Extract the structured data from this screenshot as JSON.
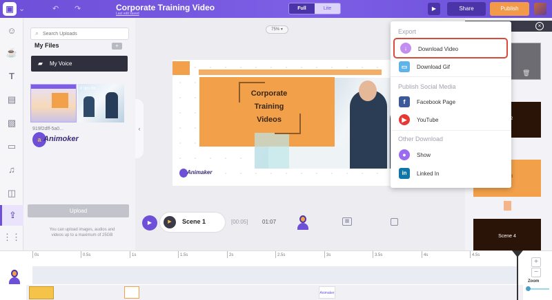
{
  "header": {
    "title": "Corporate Training Video",
    "subtitle": "Last edit saved",
    "view_toggle": [
      "Full",
      "Lite"
    ],
    "share_label": "Share",
    "publish_label": "Publish"
  },
  "rail": {
    "icons": [
      "character-icon",
      "properties-icon",
      "text-icon",
      "background-icon",
      "image-icon",
      "video-icon",
      "music-icon",
      "effect-icon",
      "upload-icon",
      "more-icon"
    ],
    "active": "upload-icon"
  },
  "panel": {
    "search_placeholder": "Search Uploads",
    "section_title": "My Files",
    "add_label": "+",
    "folder_label": "My Voice",
    "thumb2_label": "8 tips for...",
    "file_name": "919f2dff-5a0...",
    "logo_text": "Animoker",
    "upload_label": "Upload",
    "upload_note": "You can upload images, audios and videos up to a maximum of 25GB"
  },
  "canvas": {
    "zoom": "75%",
    "heading_lines": [
      "Corporate",
      "Training",
      "Videos"
    ],
    "logo_text": "Animaker"
  },
  "controls": {
    "scene_label": "Scene 1",
    "time_current": "[00:05]",
    "time_total": "01:07"
  },
  "scenes": {
    "numbers": [
      "2",
      "3"
    ],
    "scene4_label": "Scene 4"
  },
  "dropdown": {
    "categories": [
      "Export",
      "Publish Social Media",
      "Other Download"
    ],
    "items": [
      {
        "label": "Download Video",
        "icon": "download-video-icon",
        "color": "#c28ef0"
      },
      {
        "label": "Download Gif",
        "icon": "gif-icon",
        "color": "#5fb3e9"
      },
      {
        "label": "Facebook Page",
        "icon": "facebook-icon",
        "color": "#3b5998"
      },
      {
        "label": "YouTube",
        "icon": "youtube-icon",
        "color": "#e53935"
      },
      {
        "label": "Show",
        "icon": "show-icon",
        "color": "#9b6bf2"
      },
      {
        "label": "Linked In",
        "icon": "linkedin-icon",
        "color": "#0e76a8"
      }
    ],
    "highlighted": "Download Video"
  },
  "timeline": {
    "ticks": [
      "0s",
      "0.5s",
      "1s",
      "1.5s",
      "2s",
      "2.5s",
      "3s",
      "3.5s",
      "4s",
      "4.5s"
    ],
    "zoom_label": "Zoom",
    "thumb_text": "Animaker"
  },
  "colors": {
    "brand": "#6d4fd8",
    "accent_orange": "#f2a04a",
    "highlight_red": "#d9493a"
  }
}
